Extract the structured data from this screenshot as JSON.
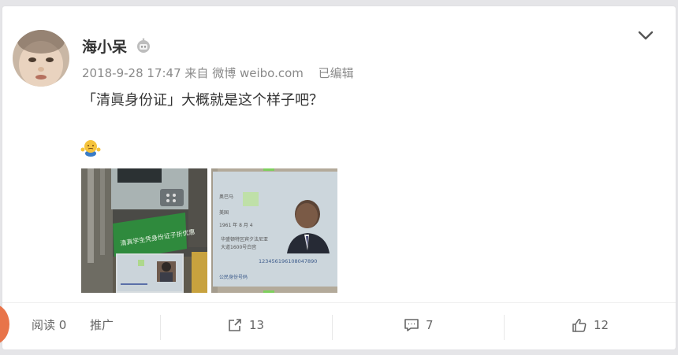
{
  "post": {
    "author": "海小呆",
    "time": "2018-9-28 17:47",
    "source_prefix": "来自",
    "source": "微博 weibo.com",
    "edited": "已编辑",
    "text": "「清眞身份证」大概就是这个样子吧？"
  },
  "card1_text": {
    "sign": "清真学生凭身份证子折优惠",
    "name": "奥巴马",
    "ethnicity": "美国",
    "birth": "1961 年 8 月 4",
    "addr1": "华盛顿特区宾夕法尼亚",
    "addr2": "大道1600号白宫",
    "idno": "123456196108047890",
    "footer": "公民身份号码"
  },
  "footer": {
    "reads_label": "阅读",
    "reads_value": "0",
    "promote": "推广",
    "reposts": "13",
    "comments": "7",
    "likes": "12"
  },
  "icons": {
    "verified": "robot-badge-icon",
    "menu": "chevron-down-icon",
    "emoji": "shrug-emoji-icon",
    "repost": "share-icon",
    "comment": "comment-icon",
    "like": "thumbs-up-icon"
  },
  "colors": {
    "gray_text": "#8a8a8a",
    "avatar_accent": "#e8744a"
  }
}
